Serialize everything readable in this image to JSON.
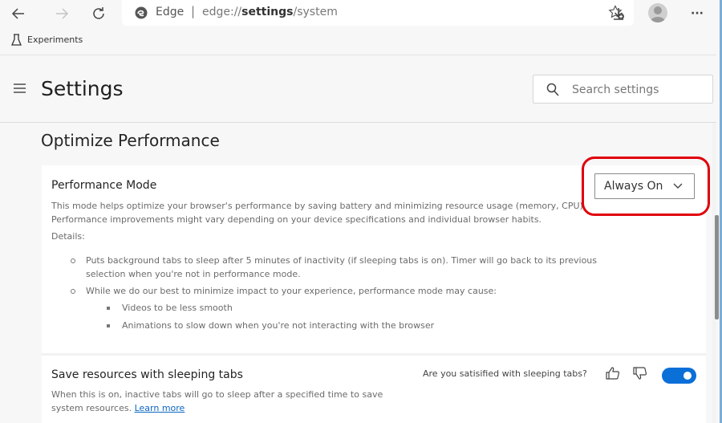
{
  "browser": {
    "address_origin": "Edge",
    "address_separator": "|",
    "url_prefix": "edge://",
    "url_bold": "settings",
    "url_suffix": "/system",
    "more_label": "···",
    "favorites": [
      {
        "label": "Experiments",
        "icon": "flask-icon"
      }
    ]
  },
  "header": {
    "title": "Settings",
    "search_placeholder": "Search settings"
  },
  "section": {
    "title": "Optimize Performance"
  },
  "performance_mode": {
    "title": "Performance Mode",
    "description": "This mode helps optimize your browser's performance by saving battery and minimizing resource usage (memory, CPU). Performance improvements might vary depending on your device specifications and individual browser habits.",
    "details_label": "Details:",
    "details": [
      {
        "text": "Puts background tabs to sleep after 5 minutes of inactivity (if sleeping tabs is on). Timer will go back to its previous selection when you're not in performance mode.",
        "sub": []
      },
      {
        "text": "While we do our best to minimize impact to your experience, performance mode may cause:",
        "sub": [
          "Videos to be less smooth",
          "Animations to slow down when you're not interacting with the browser"
        ]
      }
    ],
    "dropdown_value": "Always On",
    "highlight_color": "#e0000b"
  },
  "sleeping_tabs": {
    "title": "Save resources with sleeping tabs",
    "description": "When this is on, inactive tabs will go to sleep after a specified time to save system resources.",
    "learn_more": "Learn more",
    "feedback_question": "Are you satisified with sleeping tabs?",
    "toggle_on": true,
    "toggle_color": "#0b6fd8"
  }
}
